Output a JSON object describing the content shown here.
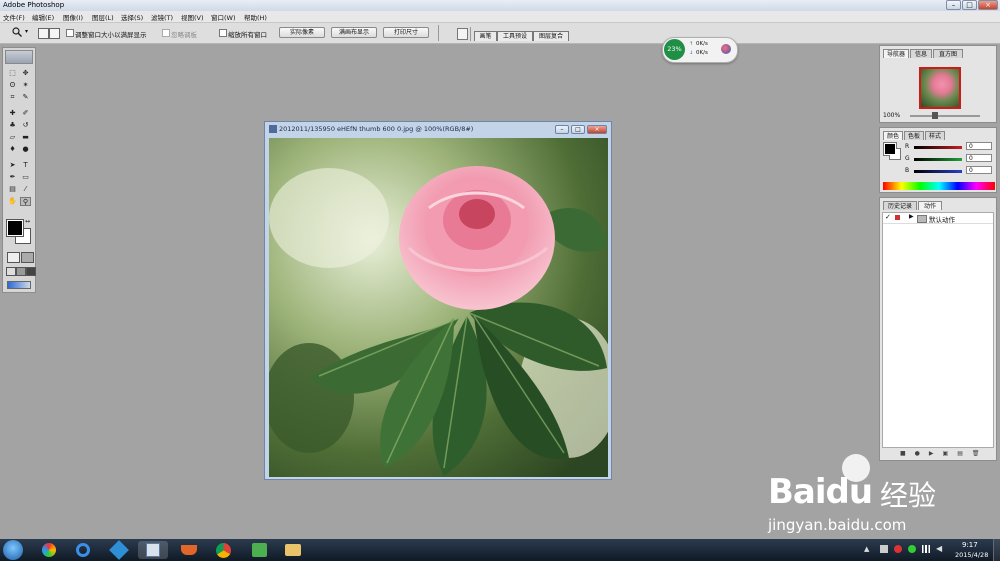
{
  "app": {
    "title": "Adobe Photoshop",
    "window_controls": [
      "–",
      "□",
      "×"
    ]
  },
  "menu": {
    "items": [
      "文件(F)",
      "编辑(E)",
      "图像(I)",
      "图层(L)",
      "选择(S)",
      "滤镜(T)",
      "视图(V)",
      "窗口(W)",
      "帮助(H)"
    ]
  },
  "options": {
    "resize_window_label": "调整窗口大小以满屏显示",
    "ignore_palettes_label": "忽略调板",
    "zoom_all_label": "缩放所有窗口",
    "actual_pixels": "实际像素",
    "fit_on_screen": "满画布显示",
    "print_size": "打印尺寸",
    "well_tabs": [
      "画笔",
      "工具预设",
      "图层复合"
    ]
  },
  "speed_widget": {
    "percent": "23%",
    "up": "0K/s",
    "down": "0K/s"
  },
  "document": {
    "title": "2012011/135950 eHEfN thumb 600 0.jpg @ 100%(RGB/8#)"
  },
  "navigator": {
    "tabs": [
      "导航器",
      "信息",
      "直方图"
    ],
    "zoom": "100%"
  },
  "color_panel": {
    "tabs": [
      "颜色",
      "色板",
      "样式"
    ],
    "channels": [
      {
        "label": "R",
        "value": "0",
        "color": "#c42020"
      },
      {
        "label": "G",
        "value": "0",
        "color": "#22a03a"
      },
      {
        "label": "B",
        "value": "0",
        "color": "#2c3fc8"
      }
    ]
  },
  "actions_panel": {
    "tabs": [
      "历史记录",
      "动作"
    ],
    "rows": [
      {
        "label": "默认动作"
      }
    ]
  },
  "taskbar": {
    "time": "9:17",
    "date": "2015/4/28"
  },
  "watermark": {
    "brand": "Baidu",
    "suffix": "经验",
    "url": "jingyan.baidu.com"
  },
  "colors": {
    "workspace": "#a3a3a3",
    "foreground": "#000000",
    "background": "#ffffff",
    "speed_green": "#1e8f45"
  }
}
